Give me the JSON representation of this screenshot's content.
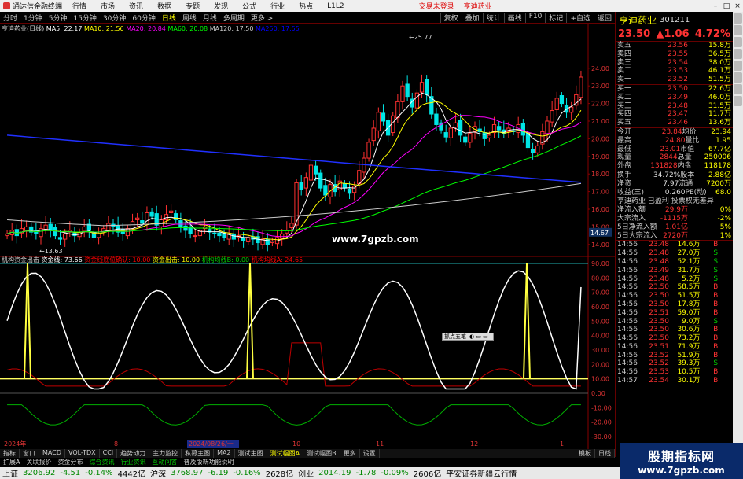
{
  "menubar": {
    "app_title": "通达信金融终端",
    "items": [
      "行情",
      "市场",
      "资讯",
      "数据",
      "专题",
      "发现",
      "公式",
      "行业",
      "热点",
      "L1L2"
    ],
    "login_warn": "交易未登录",
    "stock_name": "亨迪药业"
  },
  "toolbar": {
    "periods": [
      "分时",
      "1分钟",
      "5分钟",
      "15分钟",
      "30分钟",
      "60分钟",
      "日线",
      "周线",
      "月线",
      "多周期",
      "更多 >"
    ],
    "active_period": "日线",
    "right_items": [
      "复权",
      "叠加",
      "统计",
      "画线",
      "F10",
      "标记",
      "+自选",
      "返回"
    ]
  },
  "legend": {
    "title": "亨迪药业(日线)",
    "items": [
      {
        "label": "MA5: 22.17",
        "color": "#ffffff"
      },
      {
        "label": "MA10: 21.56",
        "color": "#ffff00"
      },
      {
        "label": "MA20: 20.84",
        "color": "#ff00ff"
      },
      {
        "label": "MA60: 20.08",
        "color": "#00ff00"
      },
      {
        "label": "MA120: 17.50",
        "color": "#cccccc"
      },
      {
        "label": "MA250: 17.55",
        "color": "#0000ff"
      }
    ]
  },
  "price_axis": [
    "24.00",
    "23.00",
    "22.00",
    "21.00",
    "20.00",
    "19.00",
    "18.00",
    "17.00",
    "16.00",
    "15.00",
    "14.00"
  ],
  "price_marks": {
    "high_label": "25.77",
    "low_label": "13.63",
    "last_tag": "14.67"
  },
  "indicator_legend": {
    "items": [
      {
        "label": "机构资金出击",
        "color": "#cccccc"
      },
      {
        "label": "资金线: 73.66",
        "color": "#ffffff"
      },
      {
        "label": "资金线底位确认: 10.00",
        "color": "#ff0000"
      },
      {
        "label": "资金出击: 10.00",
        "color": "#ffff00"
      },
      {
        "label": "机构均线B: 0.00",
        "color": "#00cc00"
      },
      {
        "label": "机构均线A: 24.65",
        "color": "#ff0000"
      }
    ]
  },
  "indicator_axis": [
    "90.00",
    "80.00",
    "70.00",
    "60.00",
    "50.00",
    "40.00",
    "30.00",
    "20.00",
    "10.00",
    "0.00",
    "-10.00",
    "-20.00",
    "-30.00"
  ],
  "date_axis": [
    "2024年",
    "8",
    "2024/08/26/一",
    "10",
    "11",
    "12",
    "1"
  ],
  "popup_label": "抓点五笔",
  "site_watermark": "www.7gpzb.com",
  "bottom_tabs": {
    "left": [
      "指标",
      "窗口",
      "MACD",
      "VOL-TDX",
      "CCI",
      "趋势动力",
      "主力监控",
      "私募主图",
      "MA2",
      "测试主图",
      "测试幅图A",
      "测试幅图B",
      "更多",
      "设置"
    ],
    "active": "测试幅图A",
    "row2": [
      "扩展A",
      "关联报价",
      "资金分布",
      "综合资讯",
      "行业资讯",
      "互动问答",
      "普及版新功能说明"
    ],
    "right_tabs": [
      "模板",
      "日线"
    ]
  },
  "status": {
    "sh_label": "上证",
    "sh_val": "3206.92",
    "sh_chg": "-4.51",
    "sh_pct": "-0.14%",
    "sh_amt": "4442亿",
    "sz_label": "沪深",
    "sz_val": "3768.97",
    "sz_chg": "-6.19",
    "sz_pct": "-0.16%",
    "sz_amt": "2628亿",
    "cy_label": "创业",
    "cy_val": "2014.19",
    "cy_chg": "-1.78",
    "cy_pct": "-0.09%",
    "cy_amt": "2606亿",
    "broker": "平安证券新疆云行情"
  },
  "quote": {
    "name": "亨迪药业",
    "code": "301211",
    "price": "23.50",
    "change": "▲1.06",
    "pct": "4.72%",
    "asks": [
      {
        "l": "卖五",
        "p": "23.56",
        "v": "15.8万"
      },
      {
        "l": "卖四",
        "p": "23.55",
        "v": "36.5万"
      },
      {
        "l": "卖三",
        "p": "23.54",
        "v": "38.0万"
      },
      {
        "l": "卖二",
        "p": "23.53",
        "v": "46.1万"
      },
      {
        "l": "卖一",
        "p": "23.52",
        "v": "51.5万"
      }
    ],
    "bids": [
      {
        "l": "买一",
        "p": "23.50",
        "v": "22.6万"
      },
      {
        "l": "买二",
        "p": "23.49",
        "v": "46.0万"
      },
      {
        "l": "买三",
        "p": "23.48",
        "v": "31.5万"
      },
      {
        "l": "买四",
        "p": "23.47",
        "v": "11.7万"
      },
      {
        "l": "买五",
        "p": "23.46",
        "v": "13.6万"
      }
    ],
    "stats": [
      {
        "a": "今开",
        "b": "23.84",
        "c": "均价",
        "d": "23.94"
      },
      {
        "a": "最高",
        "b": "24.80",
        "c": "量比",
        "d": "1.95"
      },
      {
        "a": "最低",
        "b": "23.01",
        "c": "市值",
        "d": "67.7亿"
      },
      {
        "a": "现量",
        "b": "2844",
        "c": "总量",
        "d": "250006"
      },
      {
        "a": "外盘",
        "b": "131828",
        "c": "内盘",
        "d": "118178"
      }
    ],
    "stats2": [
      {
        "a": "换手",
        "b": "34.72%",
        "c": "股本",
        "d": "2.88亿"
      },
      {
        "a": "净资",
        "b": "7.97",
        "c": "流通",
        "d": "7200万"
      },
      {
        "a": "收益(三)",
        "b": "0.260",
        "c": "PE(动)",
        "d": "68.0"
      }
    ],
    "flags": "亨迪药业 已盈利 投票权无差异",
    "flows": [
      {
        "l": "净流入额",
        "v": "29.9万",
        "p": "0%"
      },
      {
        "l": "大宗流入",
        "v": "-1115万",
        "p": "-2%"
      },
      {
        "l": "5日净流入额",
        "v": "1.01亿",
        "p": "5%"
      },
      {
        "l": "5日大宗流入",
        "v": "2720万",
        "p": "1%"
      }
    ],
    "trades": [
      {
        "t": "14:56",
        "p": "23.48",
        "v": "14.6万",
        "s": "B"
      },
      {
        "t": "14:56",
        "p": "23.48",
        "v": "27.0万",
        "s": "S"
      },
      {
        "t": "14:56",
        "p": "23.48",
        "v": "52.1万",
        "s": "S"
      },
      {
        "t": "14:56",
        "p": "23.49",
        "v": "31.7万",
        "s": "S"
      },
      {
        "t": "14:56",
        "p": "23.48",
        "v": "5.2万",
        "s": "S"
      },
      {
        "t": "14:56",
        "p": "23.50",
        "v": "58.5万",
        "s": "B"
      },
      {
        "t": "14:56",
        "p": "23.50",
        "v": "51.5万",
        "s": "B"
      },
      {
        "t": "14:56",
        "p": "23.50",
        "v": "17.8万",
        "s": "B"
      },
      {
        "t": "14:56",
        "p": "23.51",
        "v": "59.0万",
        "s": "B"
      },
      {
        "t": "14:56",
        "p": "23.50",
        "v": "9.0万",
        "s": "S"
      },
      {
        "t": "14:56",
        "p": "23.50",
        "v": "30.6万",
        "s": "B"
      },
      {
        "t": "14:56",
        "p": "23.50",
        "v": "73.2万",
        "s": "B"
      },
      {
        "t": "14:56",
        "p": "23.51",
        "v": "71.9万",
        "s": "B"
      },
      {
        "t": "14:56",
        "p": "23.52",
        "v": "51.9万",
        "s": "B"
      },
      {
        "t": "14:56",
        "p": "23.52",
        "v": "39.3万",
        "s": "S"
      },
      {
        "t": "14:56",
        "p": "23.53",
        "v": "10.5万",
        "s": "B"
      },
      {
        "t": "14:57",
        "p": "23.54",
        "v": "30.1万",
        "s": "B"
      }
    ]
  },
  "brand_watermark": {
    "top": "股期指标网",
    "bottom": "www.7gpzb.com"
  },
  "chart_data": {
    "type": "candlestick",
    "note_series": [
      "MA5",
      "MA10",
      "MA20",
      "MA60",
      "MA120",
      "MA250"
    ],
    "ylim": [
      13.5,
      26.0
    ],
    "closes": [
      14.6,
      14.8,
      14.5,
      14.9,
      15.0,
      14.7,
      14.6,
      14.9,
      15.1,
      14.8,
      14.5,
      14.3,
      14.6,
      14.8,
      14.5,
      14.7,
      15.0,
      14.8,
      14.4,
      14.6,
      14.9,
      15.2,
      15.0,
      14.7,
      14.6,
      14.9,
      15.3,
      15.5,
      15.2,
      15.8,
      15.6,
      15.1,
      15.4,
      15.7,
      15.9,
      15.4,
      15.0,
      14.8,
      14.6,
      14.5,
      14.8,
      15.0,
      14.7,
      14.6,
      14.5,
      14.4,
      14.6,
      14.3,
      14.5,
      14.2,
      14.4,
      14.3,
      14.1,
      14.3,
      14.0,
      14.2,
      14.4,
      14.6,
      14.8,
      15.2,
      17.5,
      17.1,
      17.8,
      18.5,
      18.0,
      17.2,
      16.8,
      17.4,
      17.0,
      17.6,
      17.2,
      16.9,
      17.3,
      18.2,
      18.9,
      19.8,
      20.6,
      21.5,
      21.0,
      20.2,
      21.3,
      22.1,
      23.0,
      22.4,
      21.8,
      22.6,
      23.2,
      22.5,
      21.4,
      20.8,
      20.5,
      20.1,
      20.6,
      20.9,
      20.2,
      19.8,
      20.3,
      20.7,
      20.4,
      20.0,
      20.2,
      20.8,
      20.5,
      20.3,
      20.6,
      20.4,
      20.8,
      20.2,
      19.5,
      19.2,
      19.6,
      20.4,
      21.0,
      21.6,
      22.3,
      22.0,
      21.5,
      21.8,
      22.5,
      23.5
    ],
    "indicator": {
      "ylim": [
        -30,
        90
      ],
      "fund_line_last": 73.66,
      "threshold": 10,
      "inst_a_last": 24.65
    }
  }
}
